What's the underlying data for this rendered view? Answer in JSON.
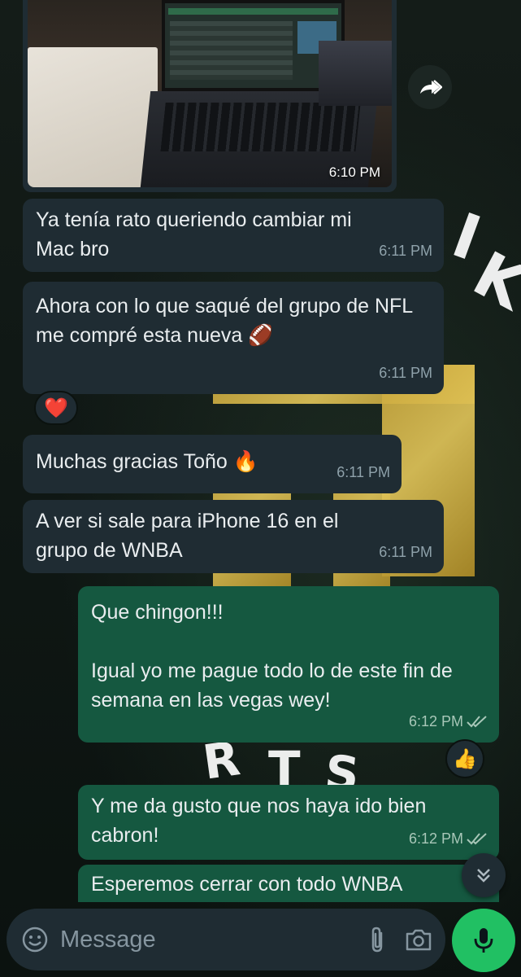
{
  "photo_message": {
    "time": "6:10 PM"
  },
  "messages": [
    {
      "text": "Ya tenía rato queriendo cambiar mi Mac bro",
      "time": "6:11 PM"
    },
    {
      "text": "Ahora con lo que saqué del grupo de NFL me compré esta nueva 🏈",
      "time": "6:11 PM",
      "reaction": "❤️"
    },
    {
      "text": "Muchas gracias Toño 🔥",
      "time": "6:11 PM"
    },
    {
      "text": "A ver si sale para iPhone 16 en el grupo de WNBA",
      "time": "6:11 PM"
    },
    {
      "line1": "Que chingon!!!",
      "line2": "Igual yo me pague todo lo de este fin de semana en las vegas wey!",
      "time": "6:12 PM",
      "reaction": "👍"
    },
    {
      "text": "Y me da gusto que nos haya ido bien cabron!",
      "time": "6:12 PM"
    },
    {
      "text": "Esperemos cerrar con todo WNBA"
    }
  ],
  "input": {
    "placeholder": "Message"
  },
  "colors": {
    "incoming": "#1f2c33",
    "outgoing": "#155840",
    "accent": "#21c063"
  },
  "icons": [
    "forward-icon",
    "emoji-icon",
    "attach-icon",
    "camera-icon",
    "mic-icon",
    "double-chevron-down-icon",
    "double-check-icon"
  ]
}
